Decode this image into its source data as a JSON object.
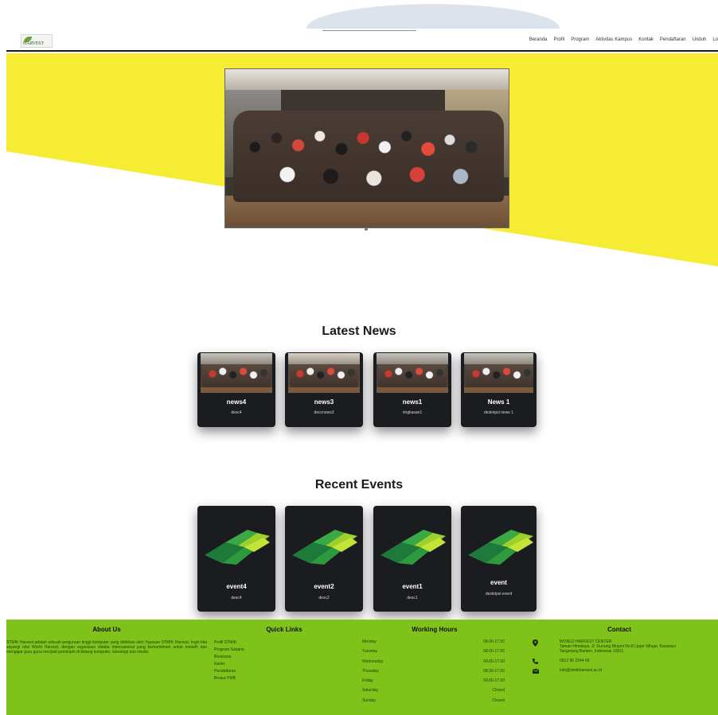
{
  "nav": {
    "logo_text": "HARVEST",
    "links": [
      "Beranda",
      "Profil",
      "Program",
      "Aktivitas Kampus",
      "Kontak",
      "Pendaftaran",
      "Unduh",
      "Lo"
    ]
  },
  "sections": {
    "news_heading": "Latest News",
    "events_heading": "Recent Events"
  },
  "news": [
    {
      "title": "news4",
      "desc": "desc4"
    },
    {
      "title": "news3",
      "desc": "deccnews3"
    },
    {
      "title": "news1",
      "desc": "ringkasan1"
    },
    {
      "title": "News 1",
      "desc": "deskripsi news 1"
    }
  ],
  "events": [
    {
      "title": "event4",
      "desc": "desc4"
    },
    {
      "title": "event2",
      "desc": "desc2"
    },
    {
      "title": "event1",
      "desc": "desc1"
    },
    {
      "title": "event",
      "desc": "deskripsi event"
    }
  ],
  "footer": {
    "about": {
      "heading": "About Us",
      "text": "STMIK Harvest adalah sebuah perguruan tinggi komputer yang didirikan oleh Yayasan STMIK Harvest. Ingin kita sayangi nilai World Harvest, dengan organisasi nirlaba internasional yang berkomitmen untuk melatih dan mengajar guru guna menjadi pemimpin di bidang komputer, teknologi dan media."
    },
    "quick_links": {
      "heading": "Quick Links",
      "items": [
        "Profil STMIK",
        "Program Sarjana",
        "Beasiswa",
        "Karier",
        "Pendaftaran",
        "Brosur PMB"
      ]
    },
    "working_hours": {
      "heading": "Working Hours",
      "rows": [
        {
          "day": "Monday",
          "time": "08.00-17.00"
        },
        {
          "day": "Tuesday",
          "time": "08.00-17.00"
        },
        {
          "day": "Wednesday",
          "time": "08.00-17.00"
        },
        {
          "day": "Thursday",
          "time": "08.00-17.00"
        },
        {
          "day": "Friday",
          "time": "08.00-17.00"
        },
        {
          "day": "Saturday",
          "time": "Closed"
        },
        {
          "day": "Sunday",
          "time": "Closed"
        }
      ]
    },
    "contact": {
      "heading": "Contact",
      "address_1": "WORLD HARVEST CENTER",
      "address_2": "Taman Himalaya, Jl. Gunung Rinjani No.8 Lippo Village, Karawaci",
      "address_3": "Tangerang Banten, Indonesia 15811",
      "phone": "0812 96 2244 66",
      "email": "info@stmikharvest.ac.id"
    }
  },
  "colors": {
    "hero_yellow": "#f7ec34",
    "footer_green": "#7fc21a",
    "card_dark": "#1b1c20"
  },
  "icons": {
    "map_pin": "map-pin-icon",
    "phone": "phone-icon",
    "email": "envelope-icon"
  }
}
